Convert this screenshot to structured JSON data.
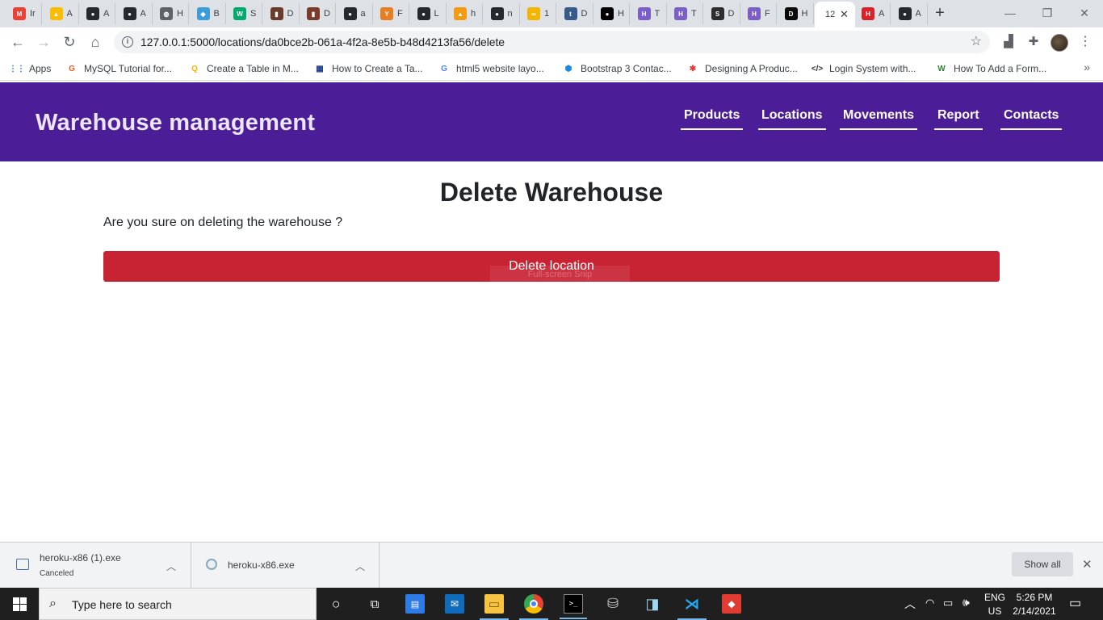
{
  "browser": {
    "tabs": [
      {
        "abbr": "Ir",
        "icon": "gmail-icon",
        "color": "#ea4335"
      },
      {
        "abbr": "A",
        "icon": "drive-icon",
        "color": "#fbbc04"
      },
      {
        "abbr": "A",
        "icon": "github-icon",
        "color": "#24292e"
      },
      {
        "abbr": "A",
        "icon": "github-icon",
        "color": "#24292e"
      },
      {
        "abbr": "H",
        "icon": "globe-icon",
        "color": "#5f6368"
      },
      {
        "abbr": "B",
        "icon": "cube-icon",
        "color": "#3b9ed8"
      },
      {
        "abbr": "S",
        "icon": "w3schools-icon",
        "color": "#04aa6d"
      },
      {
        "abbr": "D",
        "icon": "video-thumb-icon",
        "color": "#6b3a2a"
      },
      {
        "abbr": "D",
        "icon": "video-thumb-icon",
        "color": "#7a3b2b"
      },
      {
        "abbr": "a",
        "icon": "github-icon",
        "color": "#24292e"
      },
      {
        "abbr": "F",
        "icon": "yn-icon",
        "color": "#e67e22"
      },
      {
        "abbr": "L",
        "icon": "github-icon",
        "color": "#24292e"
      },
      {
        "abbr": "h",
        "icon": "triangle-icon",
        "color": "#f39c12"
      },
      {
        "abbr": "n",
        "icon": "github-icon",
        "color": "#24292e"
      },
      {
        "abbr": "1",
        "icon": "infinity-icon",
        "color": "#f5b400"
      },
      {
        "abbr": "D",
        "icon": "tds-icon",
        "color": "#355a8c"
      },
      {
        "abbr": "H",
        "icon": "medium-icon",
        "color": "#000000"
      },
      {
        "abbr": "T",
        "icon": "heroku-icon",
        "color": "#7b5ec6"
      },
      {
        "abbr": "T",
        "icon": "heroku-icon",
        "color": "#7b5ec6"
      },
      {
        "abbr": "D",
        "icon": "sa-icon",
        "color": "#2d2d2d"
      },
      {
        "abbr": "F",
        "icon": "heroku-icon",
        "color": "#7b5ec6"
      },
      {
        "abbr": "H",
        "icon": "dev-icon",
        "color": "#0a0a0a"
      },
      {
        "abbr": "12",
        "icon": "blank-icon",
        "color": "#ffffff",
        "active": true
      },
      {
        "abbr": "A",
        "icon": "heroku-red-icon",
        "color": "#d8232a"
      },
      {
        "abbr": "A",
        "icon": "github-icon",
        "color": "#24292e"
      }
    ],
    "tab_labels": {
      "gmail": "M",
      "drive": "▲",
      "github": "●",
      "globe": "◍",
      "cube": "◆",
      "w3": "W",
      "yn": "YN",
      "tds": "tds",
      "medium": "●●",
      "heroku": "H",
      "sa": "SA",
      "dev": "DEV",
      "herokured": "H"
    },
    "url": "127.0.0.1:5000/locations/da0bce2b-061a-4f2a-8e5b-b48d4213fa56/delete",
    "bookmarks": [
      {
        "label": "Apps",
        "icon": "apps-grid-icon",
        "glyph": "⋮⋮",
        "color": "#1a73e8"
      },
      {
        "label": "MySQL Tutorial for...",
        "icon": "mysql-icon",
        "glyph": "G",
        "color": "#f15a24"
      },
      {
        "label": "Create a Table in M...",
        "icon": "magnifier-doc-icon",
        "glyph": "Q",
        "color": "#f4b400"
      },
      {
        "label": "How to Create a Ta...",
        "icon": "table-grid-icon",
        "glyph": "▦",
        "color": "#1e3a8a"
      },
      {
        "label": "html5 website layo...",
        "icon": "google-icon",
        "glyph": "G",
        "color": "#4285f4"
      },
      {
        "label": "Bootstrap 3 Contac...",
        "icon": "hexagon-icon",
        "glyph": "⬢",
        "color": "#1e88e5"
      },
      {
        "label": "Designing A Produc...",
        "icon": "asterisk-icon",
        "glyph": "✱",
        "color": "#e53935"
      },
      {
        "label": "Login System with...",
        "icon": "code-icon",
        "glyph": "</>",
        "color": "#333333"
      },
      {
        "label": "How To Add a Form...",
        "icon": "w-icon",
        "glyph": "W",
        "color": "#2e7d32"
      }
    ]
  },
  "page": {
    "brand": "Warehouse management",
    "nav": [
      "Products",
      "Locations",
      "Movements",
      "Report",
      "Contacts"
    ],
    "heading": "Delete Warehouse",
    "question": "Are you sure on deleting the warehouse ?",
    "delete_button": "Delete location",
    "overlay_hint": "Full-screen Snip",
    "colors": {
      "navbar": "#4b1d96",
      "danger": "#c82333"
    }
  },
  "downloads": {
    "items": [
      {
        "name": "heroku-x86 (1).exe",
        "status": "Canceled"
      },
      {
        "name": "heroku-x86.exe",
        "status": ""
      }
    ],
    "show_all": "Show all"
  },
  "taskbar": {
    "search_placeholder": "Type here to search",
    "lang": "ENG",
    "region": "US",
    "time": "5:26 PM",
    "date": "2/14/2021"
  }
}
